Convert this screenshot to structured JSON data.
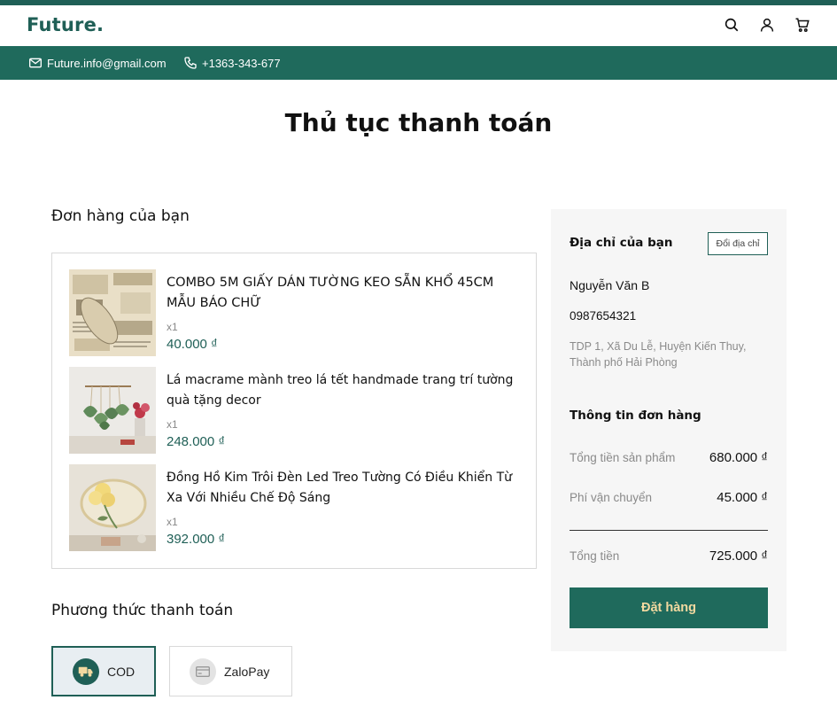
{
  "brand": {
    "logo": "Future."
  },
  "contact": {
    "email": "Future.info@gmail.com",
    "phone": "+1363-343-677"
  },
  "page": {
    "title": "Thủ tục thanh toán"
  },
  "order": {
    "title": "Đơn hàng của bạn",
    "items": [
      {
        "name": "COMBO 5M GIẤY DÁN TƯỜNG KEO SẴN KHỔ 45CM MẪU BÁO CHỮ",
        "qty": "x1",
        "price": "40.000 ₫"
      },
      {
        "name": "Lá macrame mành treo lá tết handmade trang trí tường quà tặng decor",
        "qty": "x1",
        "price": "248.000 ₫"
      },
      {
        "name": "Đồng Hồ Kim Trôi Đèn Led Treo Tường Có Điều Khiển Từ Xa Với Nhiều Chế Độ Sáng",
        "qty": "x1",
        "price": "392.000 ₫"
      }
    ]
  },
  "payment": {
    "title": "Phương thức thanh toán",
    "options": [
      {
        "label": "COD",
        "icon": "delivery-truck-icon",
        "selected": true
      },
      {
        "label": "ZaloPay",
        "icon": "card-icon",
        "selected": false
      }
    ]
  },
  "summary": {
    "address_title": "Địa chỉ của bạn",
    "change_address": "Đổi địa chỉ",
    "name": "Nguyễn Văn B",
    "phone": "0987654321",
    "address": "TDP 1, Xã Du Lễ, Huyện Kiến Thuy, Thành phố Hải Phòng",
    "info_title": "Thông tin đơn hàng",
    "subtotal_label": "Tổng tiền sản phẩm",
    "subtotal": "680.000 ₫",
    "shipping_label": "Phí vận chuyển",
    "shipping": "45.000 ₫",
    "total_label": "Tổng tiền",
    "total": "725.000 ₫",
    "place_order": "Đặt hàng"
  },
  "colors": {
    "brand": "#1f5f56",
    "bar": "#1f6a5c",
    "button_text": "#f2d9a0",
    "summary_bg": "#f6f6f6"
  }
}
